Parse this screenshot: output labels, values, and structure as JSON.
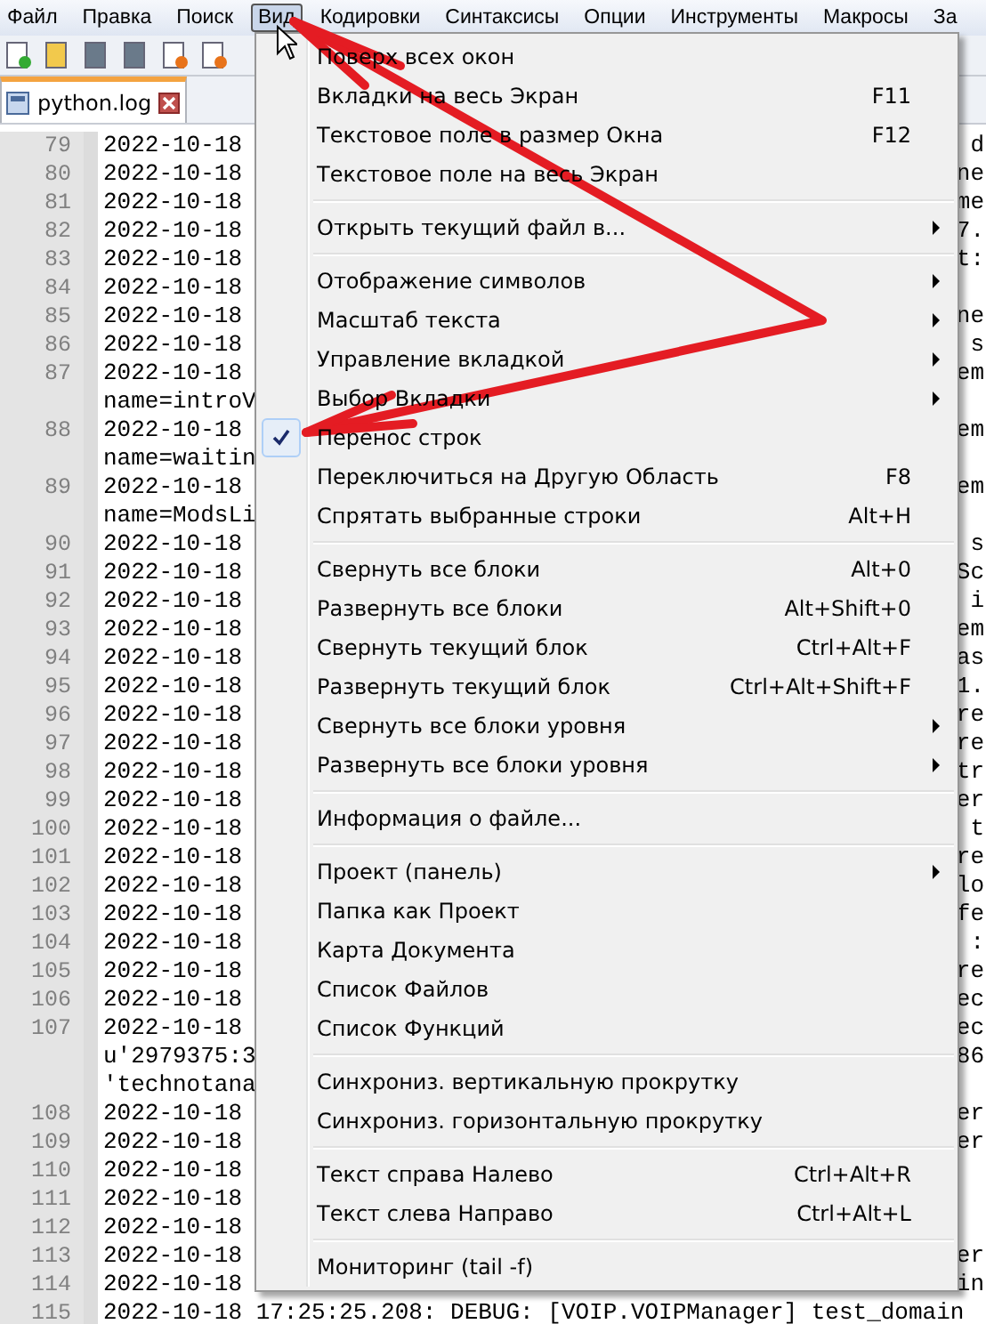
{
  "menubar": [
    {
      "label": "Файл",
      "selected": false
    },
    {
      "label": "Правка",
      "selected": false
    },
    {
      "label": "Поиск",
      "selected": false
    },
    {
      "label": "Вид",
      "selected": true
    },
    {
      "label": "Кодировки",
      "selected": false
    },
    {
      "label": "Синтаксисы",
      "selected": false
    },
    {
      "label": "Опции",
      "selected": false
    },
    {
      "label": "Инструменты",
      "selected": false
    },
    {
      "label": "Макросы",
      "selected": false
    },
    {
      "label": "За",
      "selected": false
    }
  ],
  "tab": {
    "label": "python.log"
  },
  "editor": {
    "lines": [
      {
        "number": "79",
        "text": "2022-10-18",
        "tail": "d"
      },
      {
        "number": "80",
        "text": "2022-10-18",
        "tail": "ne"
      },
      {
        "number": "81",
        "text": "2022-10-18",
        "tail": "me"
      },
      {
        "number": "82",
        "text": "2022-10-18",
        "tail": "7."
      },
      {
        "number": "83",
        "text": "2022-10-18",
        "tail": "t:"
      },
      {
        "number": "84",
        "text": "2022-10-18"
      },
      {
        "number": "85",
        "text": "2022-10-18",
        "tail": "ne"
      },
      {
        "number": "86",
        "text": "2022-10-18",
        "tail": "s"
      },
      {
        "number": "87",
        "text": "2022-10-18",
        "tail": "em"
      },
      {
        "text": "name=introV"
      },
      {
        "number": "88",
        "text": "2022-10-18",
        "tail": "em"
      },
      {
        "text": "name=waitin"
      },
      {
        "number": "89",
        "text": "2022-10-18",
        "tail": "em"
      },
      {
        "text": "name=ModsLi"
      },
      {
        "number": "90",
        "text": "2022-10-18",
        "tail": "s"
      },
      {
        "number": "91",
        "text": "2022-10-18",
        "tail": "Sc"
      },
      {
        "number": "92",
        "text": "2022-10-18",
        "tail": "i"
      },
      {
        "number": "93",
        "text": "2022-10-18",
        "tail": "em"
      },
      {
        "number": "94",
        "text": "2022-10-18",
        "tail": "as"
      },
      {
        "number": "95",
        "text": "2022-10-18",
        "tail": "1."
      },
      {
        "number": "96",
        "text": "2022-10-18",
        "tail": "re"
      },
      {
        "number": "97",
        "text": "2022-10-18",
        "tail": "re"
      },
      {
        "number": "98",
        "text": "2022-10-18",
        "tail": "tr"
      },
      {
        "number": "99",
        "text": "2022-10-18",
        "tail": "er"
      },
      {
        "number": "100",
        "text": "2022-10-18",
        "tail": "t"
      },
      {
        "number": "101",
        "text": "2022-10-18",
        "tail": "re"
      },
      {
        "number": "102",
        "text": "2022-10-18",
        "tail": "lo"
      },
      {
        "number": "103",
        "text": "2022-10-18",
        "tail": "fe"
      },
      {
        "number": "104",
        "text": "2022-10-18",
        "tail": ":"
      },
      {
        "number": "105",
        "text": "2022-10-18",
        "tail": "re"
      },
      {
        "number": "106",
        "text": "2022-10-18",
        "tail": "ec"
      },
      {
        "number": "107",
        "text": "2022-10-18",
        "tail": "ec"
      },
      {
        "text": "u'2979375:3",
        "tail": "86"
      },
      {
        "text": "'technotana"
      },
      {
        "number": "108",
        "text": "2022-10-18",
        "tail": "er"
      },
      {
        "number": "109",
        "text": "2022-10-18",
        "tail": "er"
      },
      {
        "number": "110",
        "text": "2022-10-18"
      },
      {
        "number": "111",
        "text": "2022-10-18"
      },
      {
        "number": "112",
        "text": "2022-10-18"
      },
      {
        "number": "113",
        "text": "2022-10-18",
        "tail": "er"
      },
      {
        "number": "114",
        "text": "2022-10-18",
        "tail": "in"
      },
      {
        "number": "115",
        "text": "2022-10-18 17:25:25.208: DEBUG: [VOIP.VOIPManager] test_domain"
      }
    ]
  },
  "menu": {
    "items": [
      {
        "kind": "item",
        "label": "Поверх всех окон",
        "submenu": false,
        "checked": false
      },
      {
        "kind": "item",
        "label": "Вкладки на весь Экран",
        "shortcut": "F11",
        "submenu": false,
        "checked": false
      },
      {
        "kind": "item",
        "label": "Текстовое поле в размер Окна",
        "shortcut": "F12",
        "submenu": false,
        "checked": false
      },
      {
        "kind": "item",
        "label": "Текстовое поле на весь Экран",
        "submenu": false,
        "checked": false
      },
      {
        "kind": "separator"
      },
      {
        "kind": "item",
        "label": "Открыть текущий файл в...",
        "submenu": true,
        "checked": false
      },
      {
        "kind": "separator"
      },
      {
        "kind": "item",
        "label": "Отображение символов",
        "submenu": true,
        "checked": false
      },
      {
        "kind": "item",
        "label": "Масштаб текста",
        "submenu": true,
        "checked": false
      },
      {
        "kind": "item",
        "label": "Управление вкладкой",
        "submenu": true,
        "checked": false
      },
      {
        "kind": "item",
        "label": "Выбор Вкладки",
        "submenu": true,
        "checked": false
      },
      {
        "kind": "item",
        "label": "Перенос строк",
        "submenu": false,
        "checked": true
      },
      {
        "kind": "item",
        "label": "Переключиться на Другую Область",
        "shortcut": "F8",
        "submenu": false,
        "checked": false
      },
      {
        "kind": "item",
        "label": "Спрятать выбранные строки",
        "shortcut": "Alt+H",
        "submenu": false,
        "checked": false
      },
      {
        "kind": "separator"
      },
      {
        "kind": "item",
        "label": "Свернуть все блоки",
        "shortcut": "Alt+0",
        "submenu": false,
        "checked": false
      },
      {
        "kind": "item",
        "label": "Развернуть все блоки",
        "shortcut": "Alt+Shift+0",
        "submenu": false,
        "checked": false
      },
      {
        "kind": "item",
        "label": "Свернуть текущий блок",
        "shortcut": "Ctrl+Alt+F",
        "submenu": false,
        "checked": false
      },
      {
        "kind": "item",
        "label": "Развернуть текущий блок",
        "shortcut": "Ctrl+Alt+Shift+F",
        "submenu": false,
        "checked": false
      },
      {
        "kind": "item",
        "label": "Свернуть все блоки уровня",
        "submenu": true,
        "checked": false
      },
      {
        "kind": "item",
        "label": "Развернуть все блоки уровня",
        "submenu": true,
        "checked": false
      },
      {
        "kind": "separator"
      },
      {
        "kind": "item",
        "label": "Информация о файле...",
        "submenu": false,
        "checked": false
      },
      {
        "kind": "separator"
      },
      {
        "kind": "item",
        "label": "Проект (панель)",
        "submenu": true,
        "checked": false
      },
      {
        "kind": "item",
        "label": "Папка как Проект",
        "submenu": false,
        "checked": false
      },
      {
        "kind": "item",
        "label": "Карта Документа",
        "submenu": false,
        "checked": false
      },
      {
        "kind": "item",
        "label": "Список Файлов",
        "submenu": false,
        "checked": false
      },
      {
        "kind": "item",
        "label": "Список Функций",
        "submenu": false,
        "checked": false
      },
      {
        "kind": "separator"
      },
      {
        "kind": "item",
        "label": "Синхрониз. вертикальную прокрутку",
        "submenu": false,
        "checked": false
      },
      {
        "kind": "item",
        "label": "Синхрониз. горизонтальную прокрутку",
        "submenu": false,
        "checked": false
      },
      {
        "kind": "separator"
      },
      {
        "kind": "item",
        "label": "Текст справа Налево",
        "shortcut": "Ctrl+Alt+R",
        "submenu": false,
        "checked": false
      },
      {
        "kind": "item",
        "label": "Текст слева Направо",
        "shortcut": "Ctrl+Alt+L",
        "submenu": false,
        "checked": false
      },
      {
        "kind": "separator"
      },
      {
        "kind": "item",
        "label": "Мониторинг (tail -f)",
        "submenu": false,
        "checked": false
      }
    ]
  }
}
